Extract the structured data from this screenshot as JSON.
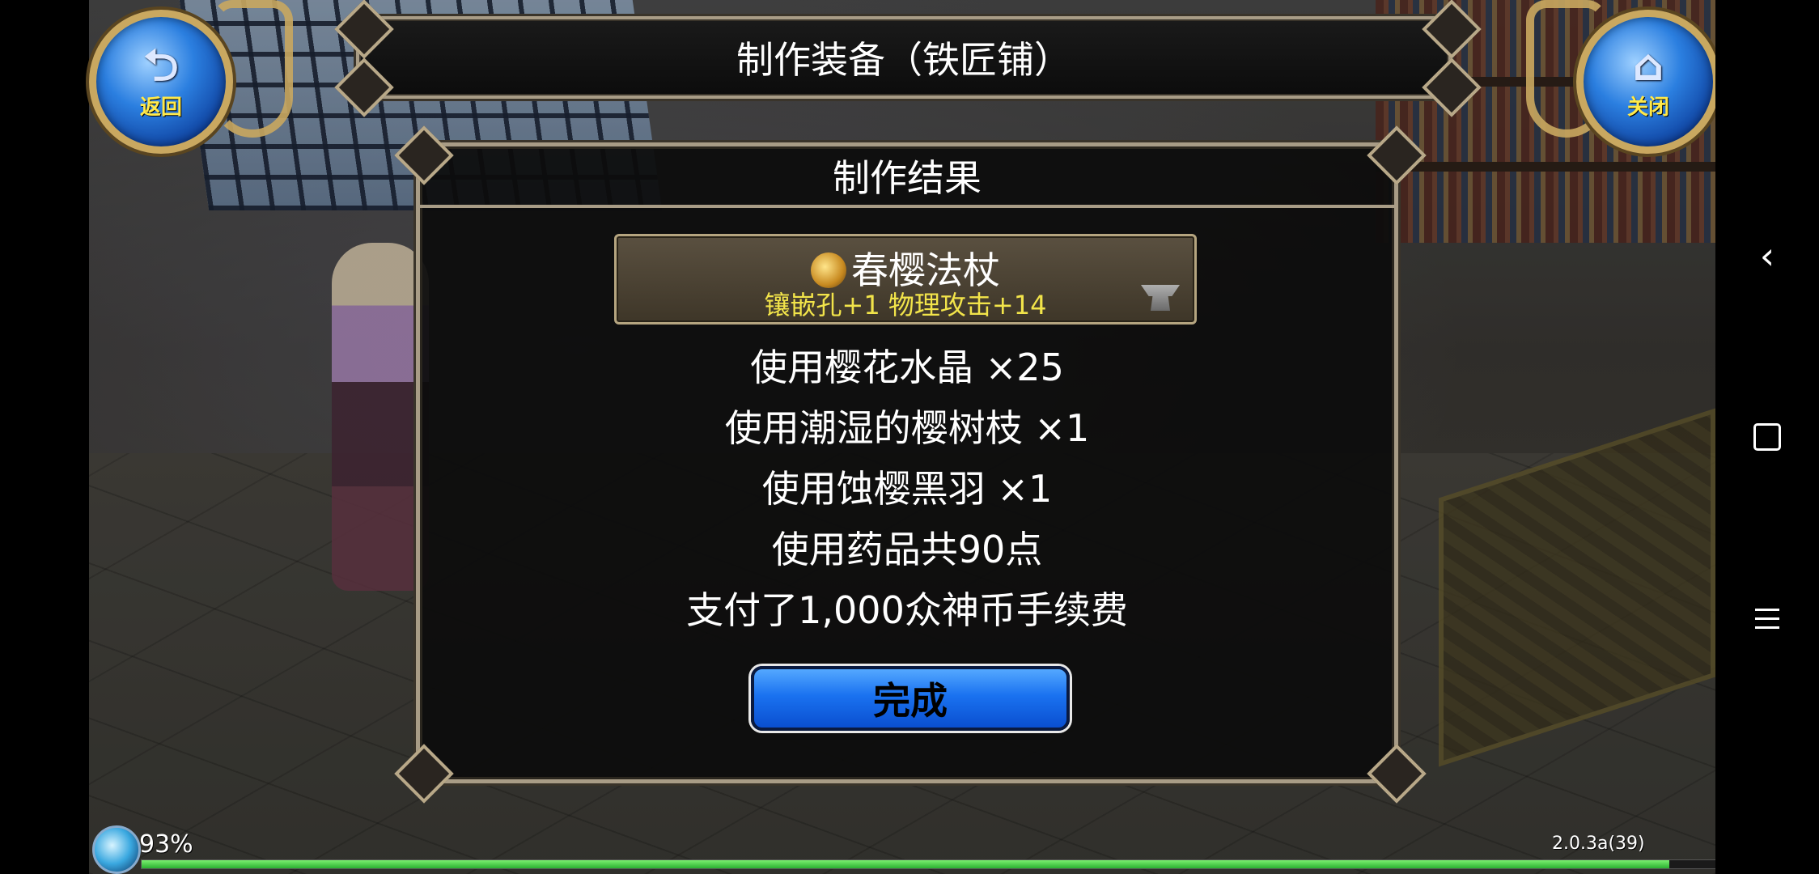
{
  "header": {
    "title": "制作装备（铁匠铺）"
  },
  "buttons": {
    "back_label": "返回",
    "close_label": "关闭"
  },
  "dialog": {
    "title": "制作结果",
    "item": {
      "name": "春樱法杖",
      "stats": "镶嵌孔+1 物理攻击+14",
      "icon": "staff-icon",
      "badge_icon": "anvil-icon"
    },
    "lines": [
      "使用樱花水晶 ×25",
      "使用潮湿的樱树枝 ×1",
      "使用蚀樱黑羽 ×1",
      "使用药品共90点",
      "支付了1,000众神币手续费"
    ],
    "done_label": "完成"
  },
  "status": {
    "battery": "93%",
    "version": "2.0.3a(39)",
    "progress_fraction": 0.97
  },
  "colors": {
    "accent_blue": "#1a72f0",
    "stat_yellow": "#f2e44a",
    "frame_gold": "#a89c86"
  }
}
